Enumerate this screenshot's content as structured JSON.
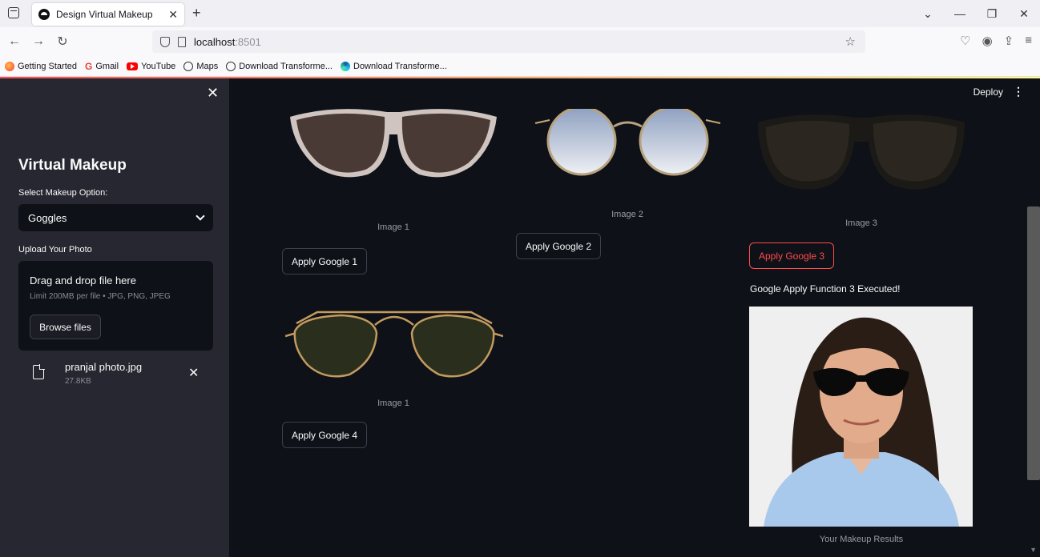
{
  "browser": {
    "tab_title": "Design Virtual Makeup",
    "url_host": "localhost",
    "url_port": ":8501",
    "bookmarks": [
      "Getting Started",
      "Gmail",
      "YouTube",
      "Maps",
      "Download Transforme...",
      "Download Transforme..."
    ]
  },
  "sidebar": {
    "title": "Virtual Makeup",
    "select_label": "Select Makeup Option:",
    "select_value": "Goggles",
    "upload_label": "Upload Your Photo",
    "drop_title": "Drag and drop file here",
    "drop_limit": "Limit 200MB per file • JPG, PNG, JPEG",
    "browse_label": "Browse files",
    "file_name": "pranjal photo.jpg",
    "file_size": "27.8KB"
  },
  "main": {
    "deploy_label": "Deploy",
    "items": [
      {
        "caption": "Image 1",
        "button": "Apply Google 1"
      },
      {
        "caption": "Image 2",
        "button": "Apply Google 2"
      },
      {
        "caption": "Image 3",
        "button": "Apply Google 3"
      },
      {
        "caption": "Image 1",
        "button": "Apply Google 4"
      }
    ],
    "status_message": "Google Apply Function 3 Executed!",
    "result_caption": "Your Makeup Results"
  },
  "colors": {
    "app_bg": "#0e1117",
    "sidebar_bg": "#262730",
    "accent": "#ff4b4b"
  }
}
